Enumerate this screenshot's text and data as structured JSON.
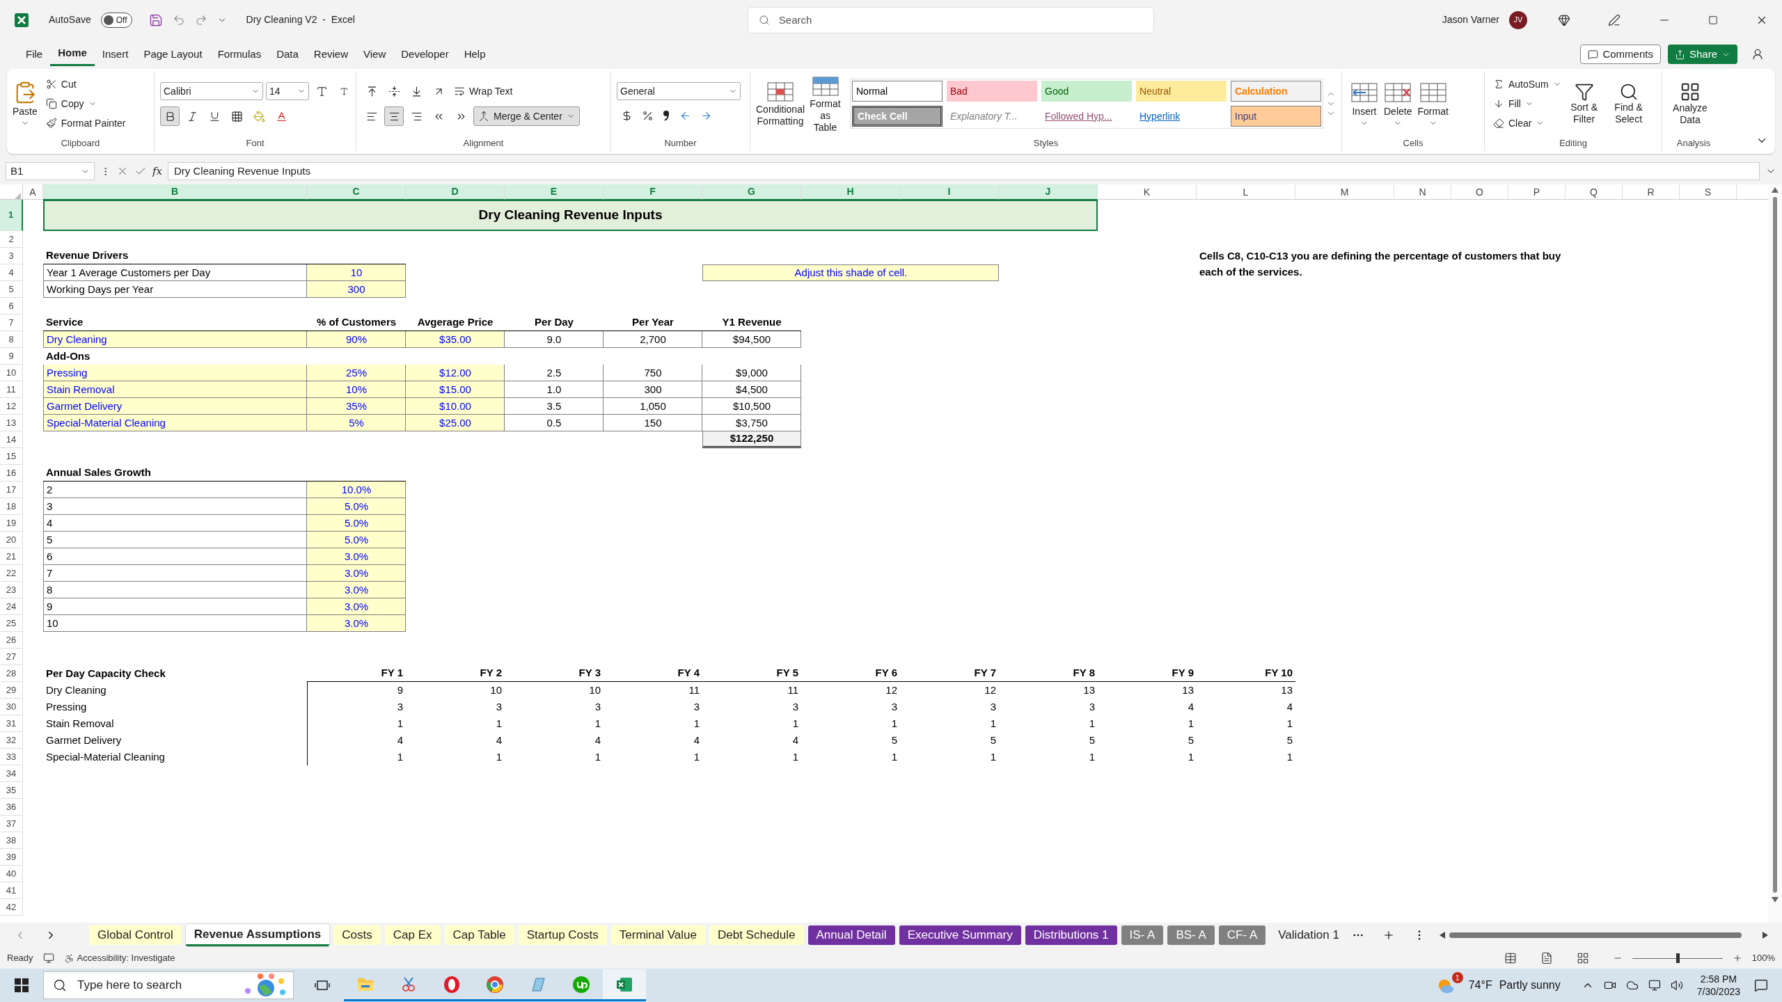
{
  "title_bar": {
    "autosave_label": "AutoSave",
    "autosave_on": false,
    "autosave_state": "Off",
    "document_title": "Dry Cleaning V2  -  Excel",
    "search_placeholder": "Search",
    "user_name": "Jason Varner",
    "user_initials": "JV"
  },
  "menu_tabs": [
    {
      "label": "File",
      "selected": false
    },
    {
      "label": "Home",
      "selected": true
    },
    {
      "label": "Insert",
      "selected": false
    },
    {
      "label": "Page Layout",
      "selected": false
    },
    {
      "label": "Formulas",
      "selected": false
    },
    {
      "label": "Data",
      "selected": false
    },
    {
      "label": "Review",
      "selected": false
    },
    {
      "label": "View",
      "selected": false
    },
    {
      "label": "Developer",
      "selected": false
    },
    {
      "label": "Help",
      "selected": false
    }
  ],
  "comments_label": "Comments",
  "share_label": "Share",
  "ribbon": {
    "clipboard": {
      "paste": "Paste",
      "cut": "Cut",
      "copy": "Copy",
      "format_painter": "Format Painter",
      "label": "Clipboard"
    },
    "font": {
      "family": "Calibri",
      "size": "14",
      "bold_on": true,
      "label": "Font"
    },
    "alignment": {
      "wrap_text": "Wrap Text",
      "merge_center": "Merge & Center",
      "center_on": true,
      "merge_on": true,
      "label": "Alignment"
    },
    "number": {
      "format": "General",
      "label": "Number"
    },
    "styles": {
      "conditional_formatting": "Conditional Formatting",
      "format_as_table": "Format as Table",
      "label": "Styles",
      "gallery": [
        {
          "kind": "normal",
          "label": "Normal"
        },
        {
          "kind": "bad",
          "label": "Bad"
        },
        {
          "kind": "good",
          "label": "Good"
        },
        {
          "kind": "neutral",
          "label": "Neutral"
        },
        {
          "kind": "calculation",
          "label": "Calculation"
        },
        {
          "kind": "check",
          "label": "Check Cell"
        },
        {
          "kind": "explanatory",
          "label": "Explanatory T..."
        },
        {
          "kind": "followed",
          "label": "Followed Hyp..."
        },
        {
          "kind": "hyperlink",
          "label": "Hyperlink"
        },
        {
          "kind": "input",
          "label": "Input"
        }
      ]
    },
    "cells": {
      "insert": "Insert",
      "delete": "Delete",
      "format": "Format",
      "label": "Cells"
    },
    "editing": {
      "autosum": "AutoSum",
      "fill": "Fill",
      "clear": "Clear",
      "sort_filter": "Sort & Filter",
      "find_select": "Find & Select",
      "label": "Editing"
    },
    "analysis": {
      "analyze_data": "Analyze Data",
      "label": "Analysis"
    }
  },
  "formula_bar": {
    "cell_ref": "B1",
    "function_label": "fx",
    "formula": "Dry Cleaning Revenue Inputs"
  },
  "columns": [
    {
      "label": "A",
      "selected": false
    },
    {
      "label": "B",
      "selected": true
    },
    {
      "label": "C",
      "selected": true
    },
    {
      "label": "D",
      "selected": true
    },
    {
      "label": "E",
      "selected": true
    },
    {
      "label": "F",
      "selected": true
    },
    {
      "label": "G",
      "selected": true
    },
    {
      "label": "H",
      "selected": true
    },
    {
      "label": "I",
      "selected": true
    },
    {
      "label": "J",
      "selected": true
    },
    {
      "label": "K",
      "selected": false
    },
    {
      "label": "L",
      "selected": false
    },
    {
      "label": "M",
      "selected": false
    },
    {
      "label": "N",
      "selected": false
    },
    {
      "label": "O",
      "selected": false
    },
    {
      "label": "P",
      "selected": false
    },
    {
      "label": "Q",
      "selected": false
    },
    {
      "label": "R",
      "selected": false
    },
    {
      "label": "S",
      "selected": false
    }
  ],
  "row_numbers": [
    "1",
    "2",
    "3",
    "4",
    "5",
    "6",
    "7",
    "8",
    "9",
    "10",
    "11",
    "12",
    "13",
    "14",
    "15",
    "16",
    "17",
    "18",
    "19",
    "20",
    "21",
    "22",
    "23",
    "24",
    "25",
    "26",
    "27",
    "28",
    "29",
    "30",
    "31",
    "32",
    "33",
    "34",
    "35",
    "36",
    "37",
    "38",
    "39",
    "40",
    "41",
    "42"
  ],
  "sheet": {
    "title": {
      "text": "Dry Cleaning Revenue Inputs",
      "selected": true
    },
    "drivers": {
      "heading": "Revenue Drivers",
      "rows": [
        {
          "label": "Year 1 Average Customers per Day",
          "value": "10"
        },
        {
          "label": "Working Days per Year",
          "value": "300"
        }
      ]
    },
    "shade_note": "Adjust this shade of cell.",
    "side_note": "Cells C8, C10-C13 you are defining the percentage of customers that buy each of the services.",
    "services": {
      "columns": [
        "Service",
        "% of Customers",
        "Avgerage Price",
        "Per Day",
        "Per Year",
        "Y1 Revenue"
      ],
      "main": [
        {
          "service": "Dry Cleaning",
          "share": "90%",
          "price": "$35.00",
          "per_day": "9.0",
          "per_year": "2,700",
          "revenue": "$94,500"
        }
      ],
      "addons_heading": "Add-Ons",
      "addons": [
        {
          "service": "Pressing",
          "share": "25%",
          "price": "$12.00",
          "per_day": "2.5",
          "per_year": "750",
          "revenue": "$9,000"
        },
        {
          "service": "Stain Removal",
          "share": "10%",
          "price": "$15.00",
          "per_day": "1.0",
          "per_year": "300",
          "revenue": "$4,500"
        },
        {
          "service": "Garmet Delivery",
          "share": "35%",
          "price": "$10.00",
          "per_day": "3.5",
          "per_year": "1,050",
          "revenue": "$10,500"
        },
        {
          "service": "Special-Material Cleaning",
          "share": "5%",
          "price": "$25.00",
          "per_day": "0.5",
          "per_year": "150",
          "revenue": "$3,750"
        }
      ],
      "total": "$122,250"
    },
    "growth": {
      "heading": "Annual Sales Growth",
      "rows": [
        {
          "year": "2",
          "rate": "10.0%"
        },
        {
          "year": "3",
          "rate": "5.0%"
        },
        {
          "year": "4",
          "rate": "5.0%"
        },
        {
          "year": "5",
          "rate": "5.0%"
        },
        {
          "year": "6",
          "rate": "3.0%"
        },
        {
          "year": "7",
          "rate": "3.0%"
        },
        {
          "year": "8",
          "rate": "3.0%"
        },
        {
          "year": "9",
          "rate": "3.0%"
        },
        {
          "year": "10",
          "rate": "3.0%"
        }
      ]
    },
    "capacity": {
      "heading": "Per Day Capacity Check",
      "years": [
        "FY 1",
        "FY 2",
        "FY 3",
        "FY 4",
        "FY 5",
        "FY 6",
        "FY 7",
        "FY 8",
        "FY 9",
        "FY 10"
      ],
      "rows": [
        {
          "service": "Dry Cleaning",
          "values": [
            "9",
            "10",
            "10",
            "11",
            "11",
            "12",
            "12",
            "13",
            "13",
            "13"
          ]
        },
        {
          "service": "Pressing",
          "values": [
            "3",
            "3",
            "3",
            "3",
            "3",
            "3",
            "3",
            "3",
            "4",
            "4"
          ]
        },
        {
          "service": "Stain Removal",
          "values": [
            "1",
            "1",
            "1",
            "1",
            "1",
            "1",
            "1",
            "1",
            "1",
            "1"
          ]
        },
        {
          "service": "Garmet Delivery",
          "values": [
            "4",
            "4",
            "4",
            "4",
            "4",
            "5",
            "5",
            "5",
            "5",
            "5"
          ]
        },
        {
          "service": "Special-Material Cleaning",
          "values": [
            "1",
            "1",
            "1",
            "1",
            "1",
            "1",
            "1",
            "1",
            "1",
            "1"
          ]
        }
      ]
    }
  },
  "sheet_tabs": [
    {
      "label": "Global Control",
      "color": "#ffffcc",
      "selected": false
    },
    {
      "label": "Revenue Assumptions",
      "color": "#ffffff",
      "selected": true
    },
    {
      "label": "Costs",
      "color": "#ffffcc",
      "selected": false
    },
    {
      "label": "Cap Ex",
      "color": "#ffffcc",
      "selected": false
    },
    {
      "label": "Cap Table",
      "color": "#ffffcc",
      "selected": false
    },
    {
      "label": "Startup Costs",
      "color": "#ffffcc",
      "selected": false
    },
    {
      "label": "Terminal Value",
      "color": "#ffffcc",
      "selected": false
    },
    {
      "label": "Debt Schedule",
      "color": "#ffffcc",
      "selected": false
    },
    {
      "label": "Annual Detail",
      "color": "#7030a0",
      "selected": false
    },
    {
      "label": "Executive Summary",
      "color": "#7030a0",
      "selected": false
    },
    {
      "label": "Distributions 1",
      "color": "#7030a0",
      "selected": false
    },
    {
      "label": "IS- A",
      "color": "#808080",
      "selected": false
    },
    {
      "label": "BS- A",
      "color": "#808080",
      "selected": false
    },
    {
      "label": "CF- A",
      "color": "#808080",
      "selected": false
    },
    {
      "label": "Validation 1",
      "color": "#f3f3f3",
      "selected": false
    }
  ],
  "status_bar": {
    "mode": "Ready",
    "accessibility": "Accessibility: Investigate",
    "zoom": {
      "level": 0.5,
      "reading": "100%"
    }
  },
  "taskbar": {
    "search_placeholder": "Type here to search",
    "apps": [
      {
        "kind": "taskview",
        "running": false
      },
      {
        "kind": "explorer",
        "running": true
      },
      {
        "kind": "snip",
        "running": true
      },
      {
        "kind": "opera",
        "running": true
      },
      {
        "kind": "chrome",
        "running": true
      },
      {
        "kind": "notepad",
        "running": true
      },
      {
        "kind": "upwork",
        "running": true
      },
      {
        "kind": "excel",
        "running": true
      }
    ],
    "weather_badge": "1",
    "temperature": "74°F",
    "weather": "Partly sunny",
    "time": "2:58 PM",
    "date": "7/30/2023"
  }
}
